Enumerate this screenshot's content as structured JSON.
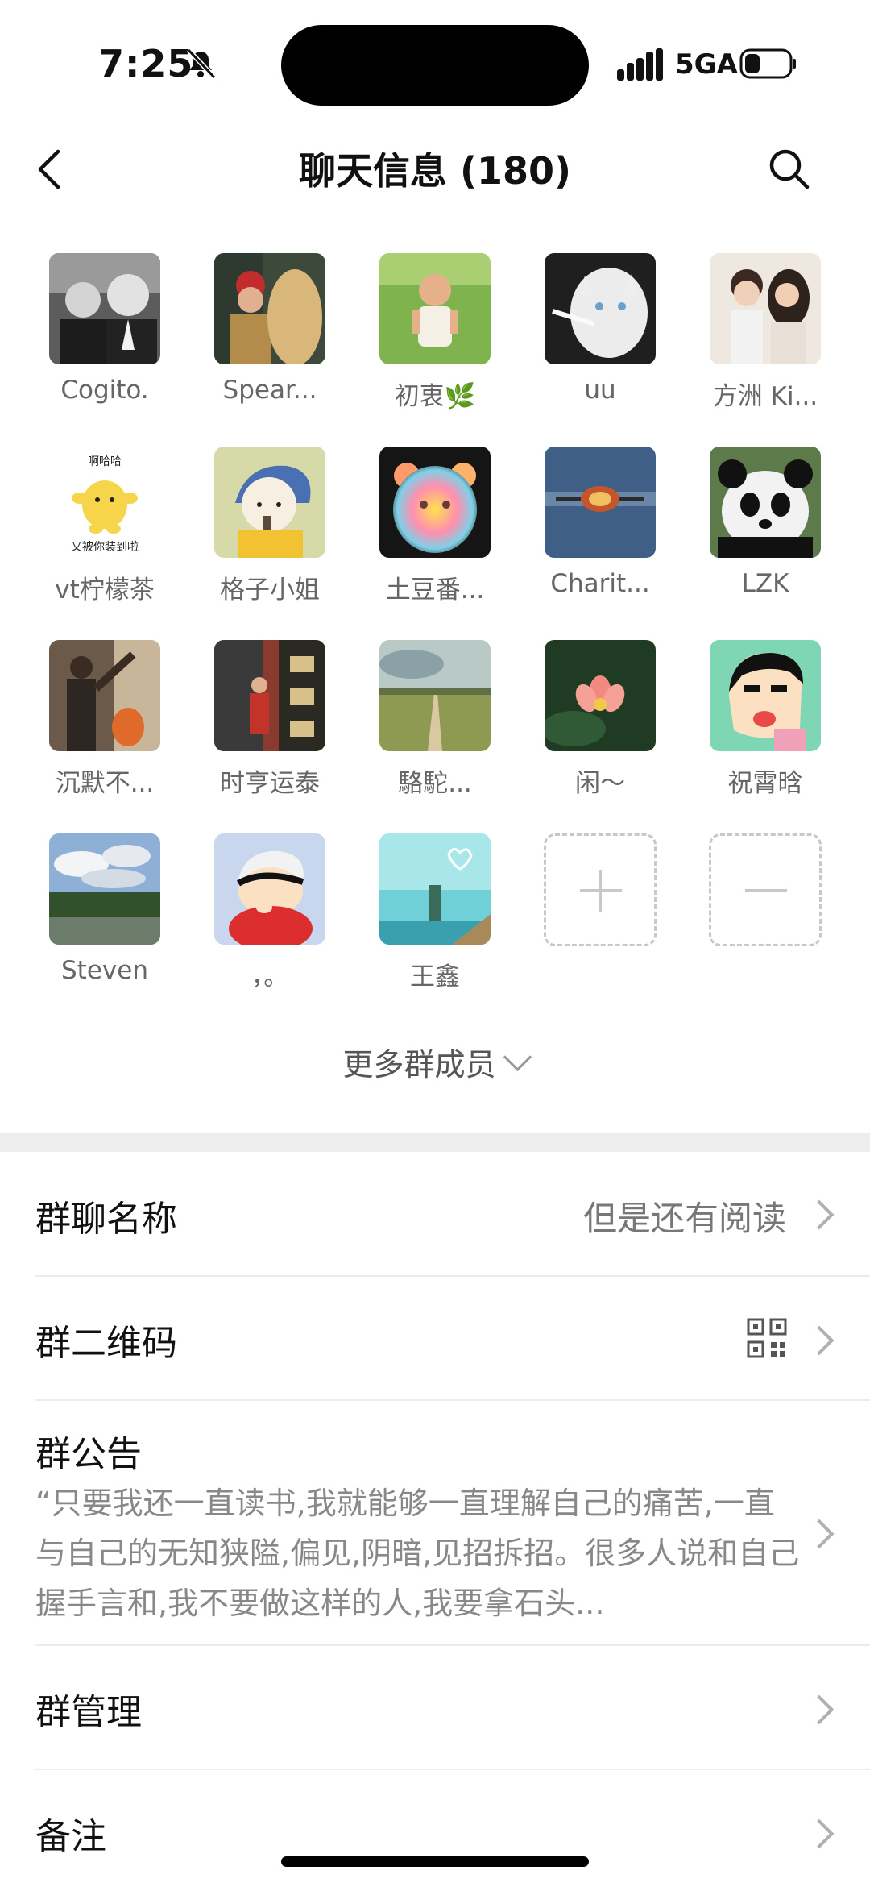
{
  "status": {
    "time": "7:25",
    "network": "5GA"
  },
  "nav": {
    "title": "聊天信息 (180)"
  },
  "members": [
    {
      "name": "Cogito."
    },
    {
      "name": "Spear..."
    },
    {
      "name": "初衷🌿"
    },
    {
      "name": "uu"
    },
    {
      "name": "方洲 Ki..."
    },
    {
      "name": "vt柠檬茶"
    },
    {
      "name": "格子小姐"
    },
    {
      "name": "土豆番..."
    },
    {
      "name": "Charit..."
    },
    {
      "name": "LZK"
    },
    {
      "name": "沉默不..."
    },
    {
      "name": "时亨运泰"
    },
    {
      "name": "駱駝..."
    },
    {
      "name": "闲～"
    },
    {
      "name": "祝霄晗"
    },
    {
      "name": "Steven"
    },
    {
      "name": "，。"
    },
    {
      "name": "王鑫"
    }
  ],
  "avatar_text": {
    "smile_top": "啊哈哈",
    "smile_bottom": "又被你装到啦"
  },
  "more_members": "更多群成员",
  "settings": {
    "group_name_label": "群聊名称",
    "group_name_value": "但是还有阅读",
    "qr_label": "群二维码",
    "announcement_label": "群公告",
    "announcement_text": "“只要我还一直读书,我就能够一直理解自己的痛苦,一直与自己的无知狭隘,偏见,阴暗,见招拆招。很多人说和自己握手言和,我不要做这样的人,我要拿石头...",
    "manage_label": "群管理",
    "remark_label": "备注"
  },
  "colors": {
    "background": "#ffffff",
    "separator": "#ededed",
    "secondary_text": "#666666"
  }
}
